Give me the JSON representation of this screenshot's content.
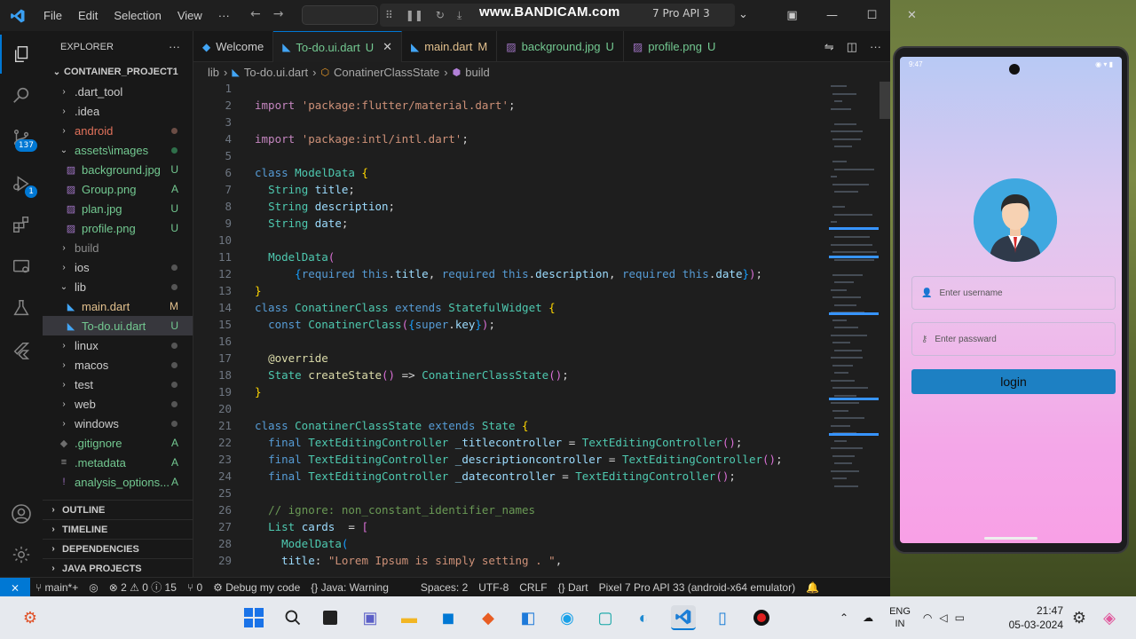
{
  "titlebar": {
    "menu": [
      "File",
      "Edit",
      "Selection",
      "View",
      "···"
    ],
    "watermark": "www.BANDICAM.com",
    "api_text": "7 Pro API 3",
    "window_controls": [
      "minimize",
      "maximize",
      "close"
    ]
  },
  "activity_bar": {
    "source_control_badge": "137",
    "debug_badge": "1"
  },
  "sidebar": {
    "header": "EXPLORER",
    "project": "CONTAINER_PROJECT1",
    "tree": [
      {
        "label": ".dart_tool",
        "type": "folder",
        "indent": 1,
        "status": "",
        "color": "#cccccc"
      },
      {
        "label": ".idea",
        "type": "folder",
        "indent": 1,
        "status": "",
        "color": "#cccccc"
      },
      {
        "label": "android",
        "type": "folder",
        "indent": 1,
        "status": "dot",
        "color": "#e2725b"
      },
      {
        "label": "assets\\images",
        "type": "folder-open",
        "indent": 1,
        "status": "dot-green",
        "color": "#73c991"
      },
      {
        "label": "background.jpg",
        "type": "image",
        "indent": 2,
        "status": "U",
        "color": "#73c991"
      },
      {
        "label": "Group.png",
        "type": "image",
        "indent": 2,
        "status": "A",
        "color": "#73c991"
      },
      {
        "label": "plan.jpg",
        "type": "image",
        "indent": 2,
        "status": "U",
        "color": "#73c991"
      },
      {
        "label": "profile.png",
        "type": "image",
        "indent": 2,
        "status": "U",
        "color": "#73c991"
      },
      {
        "label": "build",
        "type": "folder",
        "indent": 1,
        "status": "",
        "color": "#8c8c8c"
      },
      {
        "label": "ios",
        "type": "folder",
        "indent": 1,
        "status": "dot",
        "color": "#cccccc"
      },
      {
        "label": "lib",
        "type": "folder-open",
        "indent": 1,
        "status": "dot",
        "color": "#cccccc"
      },
      {
        "label": "main.dart",
        "type": "dart",
        "indent": 2,
        "status": "M",
        "color": "#e2c08d"
      },
      {
        "label": "To-do.ui.dart",
        "type": "dart",
        "indent": 2,
        "status": "U",
        "color": "#73c991",
        "selected": true
      },
      {
        "label": "linux",
        "type": "folder",
        "indent": 1,
        "status": "dot",
        "color": "#cccccc"
      },
      {
        "label": "macos",
        "type": "folder",
        "indent": 1,
        "status": "dot",
        "color": "#cccccc"
      },
      {
        "label": "test",
        "type": "folder",
        "indent": 1,
        "status": "dot",
        "color": "#cccccc"
      },
      {
        "label": "web",
        "type": "folder",
        "indent": 1,
        "status": "dot",
        "color": "#cccccc"
      },
      {
        "label": "windows",
        "type": "folder",
        "indent": 1,
        "status": "dot",
        "color": "#cccccc"
      },
      {
        "label": ".gitignore",
        "type": "git",
        "indent": 1,
        "status": "A",
        "color": "#73c991"
      },
      {
        "label": ".metadata",
        "type": "file",
        "indent": 1,
        "status": "A",
        "color": "#73c991"
      },
      {
        "label": "analysis_options...",
        "type": "yaml",
        "indent": 1,
        "status": "A",
        "color": "#73c991"
      }
    ],
    "sections": [
      "OUTLINE",
      "TIMELINE",
      "DEPENDENCIES",
      "JAVA PROJECTS"
    ]
  },
  "tabs": [
    {
      "label": "Welcome",
      "status": "",
      "icon": "vscode-icon",
      "active": false
    },
    {
      "label": "To-do.ui.dart",
      "status": "U",
      "icon": "dart-icon",
      "active": true
    },
    {
      "label": "main.dart",
      "status": "M",
      "icon": "dart-icon",
      "active": false
    },
    {
      "label": "background.jpg",
      "status": "U",
      "icon": "image-icon",
      "active": false
    },
    {
      "label": "profile.png",
      "status": "U",
      "icon": "image-icon",
      "active": false
    }
  ],
  "breadcrumb": [
    "lib",
    "To-do.ui.dart",
    "ConatinerClassState",
    "build"
  ],
  "code_lines": [
    [],
    [
      [
        "kw2",
        "import "
      ],
      [
        "str",
        "'package:flutter/material.dart'"
      ],
      [
        "pun",
        ";"
      ]
    ],
    [],
    [
      [
        "kw2",
        "import "
      ],
      [
        "str",
        "'package:intl/intl.dart'"
      ],
      [
        "pun",
        ";"
      ]
    ],
    [],
    [
      [
        "kw",
        "class "
      ],
      [
        "cls",
        "ModelData "
      ],
      [
        "br1",
        "{"
      ]
    ],
    [
      [
        "pun",
        "  "
      ],
      [
        "cls",
        "String "
      ],
      [
        "var",
        "title"
      ],
      [
        "pun",
        ";"
      ]
    ],
    [
      [
        "pun",
        "  "
      ],
      [
        "cls",
        "String "
      ],
      [
        "var",
        "description"
      ],
      [
        "pun",
        ";"
      ]
    ],
    [
      [
        "pun",
        "  "
      ],
      [
        "cls",
        "String "
      ],
      [
        "var",
        "date"
      ],
      [
        "pun",
        ";"
      ]
    ],
    [],
    [
      [
        "pun",
        "  "
      ],
      [
        "cls",
        "ModelData"
      ],
      [
        "br2",
        "("
      ]
    ],
    [
      [
        "pun",
        "      "
      ],
      [
        "br3",
        "{"
      ],
      [
        "kw",
        "required "
      ],
      [
        "kw",
        "this"
      ],
      [
        "pun",
        "."
      ],
      [
        "var",
        "title"
      ],
      [
        "pun",
        ", "
      ],
      [
        "kw",
        "required "
      ],
      [
        "kw",
        "this"
      ],
      [
        "pun",
        "."
      ],
      [
        "var",
        "description"
      ],
      [
        "pun",
        ", "
      ],
      [
        "kw",
        "required "
      ],
      [
        "kw",
        "this"
      ],
      [
        "pun",
        "."
      ],
      [
        "var",
        "date"
      ],
      [
        "br3",
        "}"
      ],
      [
        "br2",
        ")"
      ],
      [
        "pun",
        ";"
      ]
    ],
    [
      [
        "br1",
        "}"
      ]
    ],
    [
      [
        "kw",
        "class "
      ],
      [
        "cls",
        "ConatinerClass "
      ],
      [
        "kw",
        "extends "
      ],
      [
        "cls",
        "StatefulWidget "
      ],
      [
        "br1",
        "{"
      ]
    ],
    [
      [
        "pun",
        "  "
      ],
      [
        "kw",
        "const "
      ],
      [
        "cls",
        "ConatinerClass"
      ],
      [
        "br2",
        "("
      ],
      [
        "br3",
        "{"
      ],
      [
        "kw",
        "super"
      ],
      [
        "pun",
        "."
      ],
      [
        "var",
        "key"
      ],
      [
        "br3",
        "}"
      ],
      [
        "br2",
        ")"
      ],
      [
        "pun",
        ";"
      ]
    ],
    [],
    [
      [
        "pun",
        "  "
      ],
      [
        "ann",
        "@override"
      ]
    ],
    [
      [
        "pun",
        "  "
      ],
      [
        "cls",
        "State "
      ],
      [
        "fn",
        "createState"
      ],
      [
        "br2",
        "()"
      ],
      [
        "pun",
        " => "
      ],
      [
        "cls",
        "ConatinerClassState"
      ],
      [
        "br2",
        "()"
      ],
      [
        "pun",
        ";"
      ]
    ],
    [
      [
        "br1",
        "}"
      ]
    ],
    [],
    [
      [
        "kw",
        "class "
      ],
      [
        "cls",
        "ConatinerClassState "
      ],
      [
        "kw",
        "extends "
      ],
      [
        "cls",
        "State "
      ],
      [
        "br1",
        "{"
      ]
    ],
    [
      [
        "pun",
        "  "
      ],
      [
        "kw",
        "final "
      ],
      [
        "cls",
        "TextEditingController "
      ],
      [
        "var",
        "_titlecontroller"
      ],
      [
        "pun",
        " = "
      ],
      [
        "cls",
        "TextEditingController"
      ],
      [
        "br2",
        "()"
      ],
      [
        "pun",
        ";"
      ]
    ],
    [
      [
        "pun",
        "  "
      ],
      [
        "kw",
        "final "
      ],
      [
        "cls",
        "TextEditingController "
      ],
      [
        "var",
        "_descriptioncontroller"
      ],
      [
        "pun",
        " = "
      ],
      [
        "cls",
        "TextEditingController"
      ],
      [
        "br2",
        "()"
      ],
      [
        "pun",
        ";"
      ]
    ],
    [
      [
        "pun",
        "  "
      ],
      [
        "kw",
        "final "
      ],
      [
        "cls",
        "TextEditingController "
      ],
      [
        "var",
        "_datecontroller"
      ],
      [
        "pun",
        " = "
      ],
      [
        "cls",
        "TextEditingController"
      ],
      [
        "br2",
        "()"
      ],
      [
        "pun",
        ";"
      ]
    ],
    [],
    [
      [
        "pun",
        "  "
      ],
      [
        "cmt",
        "// ignore: non_constant_identifier_names"
      ]
    ],
    [
      [
        "pun",
        "  "
      ],
      [
        "cls",
        "List "
      ],
      [
        "var",
        "cards"
      ],
      [
        "pun",
        "  = "
      ],
      [
        "br2",
        "["
      ]
    ],
    [
      [
        "pun",
        "    "
      ],
      [
        "cls",
        "ModelData"
      ],
      [
        "br3",
        "("
      ]
    ],
    [
      [
        "pun",
        "    "
      ],
      [
        "var",
        "title"
      ],
      [
        "pun",
        ": "
      ],
      [
        "str",
        "\"Lorem Ipsum is simply setting . \""
      ],
      [
        "pun",
        ","
      ]
    ]
  ],
  "statusbar": {
    "branch": "main*+",
    "problems": "⊗ 2 ⚠ 0 ⓘ 15",
    "ports": "0",
    "debug": "Debug my code",
    "java": "{} Java: Warning",
    "spaces": "Spaces: 2",
    "encoding": "UTF-8",
    "eol": "CRLF",
    "language": "{} Dart",
    "device": "Pixel 7 Pro API 33 (android-x64 emulator)"
  },
  "phone": {
    "time": "9:47",
    "username_placeholder": "Enter username",
    "password_placeholder": "Enter passward",
    "login_label": "login"
  },
  "taskbar": {
    "lang_line1": "ENG",
    "lang_line2": "IN",
    "time": "21:47",
    "date": "05-03-2024"
  },
  "colors": {
    "accent": "#0078d4",
    "login_button": "#1d80c3",
    "untracked": "#73c991",
    "modified": "#e2c08d"
  }
}
